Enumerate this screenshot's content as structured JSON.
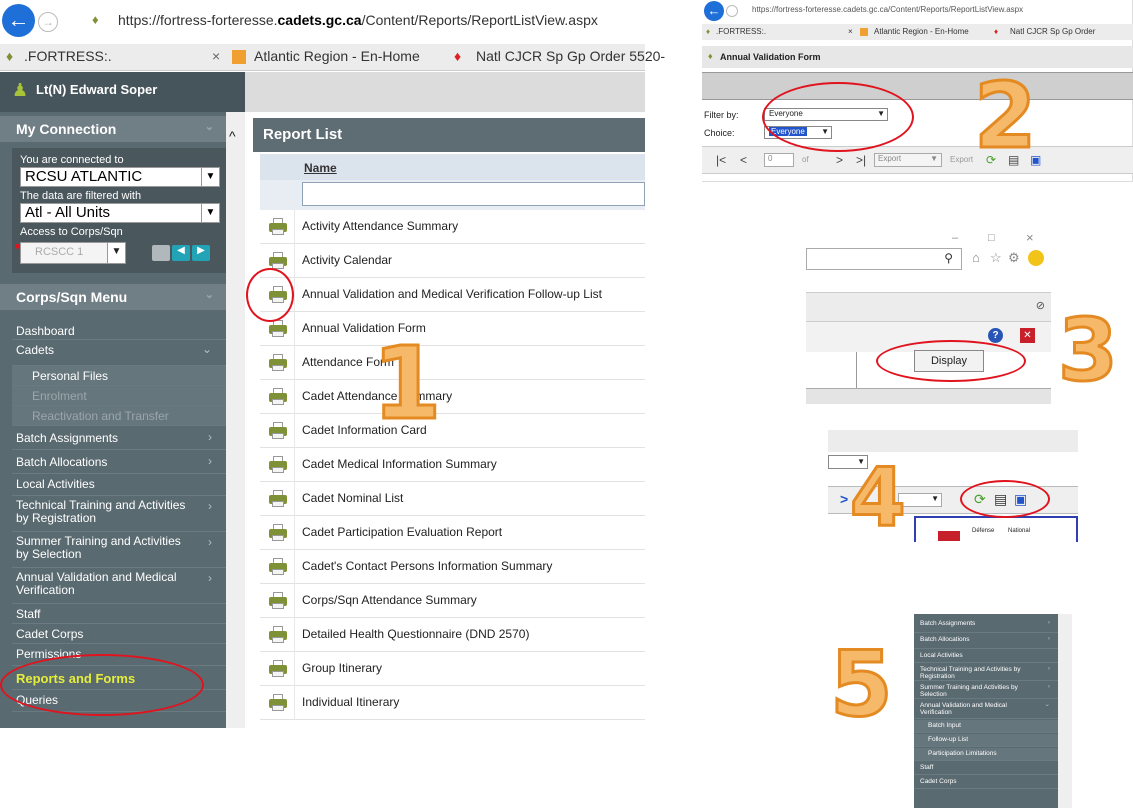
{
  "step_numbers": [
    "1",
    "2",
    "3",
    "4",
    "5"
  ],
  "browser": {
    "url_prefix": "https://fortress-forteresse.",
    "url_domain": "cadets.gc.ca",
    "url_path": "/Content/Reports/ReportListView.aspx",
    "tabs": [
      ".FORTRESS:.",
      "Atlantic Region - En-Home",
      "Natl CJCR Sp Gp Order 5520-"
    ]
  },
  "user": {
    "name": "Lt(N) Edward Soper"
  },
  "connection": {
    "title": "My Connection",
    "connected_label": "You are connected to",
    "connected_value": "RCSU ATLANTIC",
    "filtered_label": "The data are filtered with",
    "filtered_value": "Atl - All Units",
    "access_label": "Access to Corps/Sqn",
    "access_value": "RCSCC 1"
  },
  "menu": {
    "title": "Corps/Sqn Menu",
    "items": [
      {
        "label": "Dashboard",
        "type": "item",
        "chev": ""
      },
      {
        "label": "Cadets",
        "type": "item",
        "chev": "⌄"
      },
      {
        "label": "Personal Files",
        "type": "sub",
        "chev": ""
      },
      {
        "label": "Enrolment",
        "type": "sub-dis",
        "chev": ""
      },
      {
        "label": "Reactivation and Transfer",
        "type": "sub-dis",
        "chev": ""
      },
      {
        "label": "Batch Assignments",
        "type": "item",
        "chev": "›"
      },
      {
        "label": "Batch Allocations",
        "type": "item",
        "chev": "›"
      },
      {
        "label": "Local Activities",
        "type": "item",
        "chev": ""
      },
      {
        "label": "Technical Training and Activities by Registration",
        "type": "item",
        "chev": "›"
      },
      {
        "label": "Summer Training and Activities by Selection",
        "type": "item",
        "chev": "›"
      },
      {
        "label": "Annual Validation and Medical Verification",
        "type": "item",
        "chev": "›"
      },
      {
        "label": "Staff",
        "type": "item",
        "chev": ""
      },
      {
        "label": "Cadet Corps",
        "type": "item",
        "chev": ""
      },
      {
        "label": "Permissions",
        "type": "item",
        "chev": ""
      },
      {
        "label": "Reports and Forms",
        "type": "active",
        "chev": ""
      },
      {
        "label": "Queries",
        "type": "item",
        "chev": ""
      }
    ]
  },
  "report_list": {
    "title": "Report List",
    "column_name": "Name",
    "rows": [
      "Activity Attendance Summary",
      "Activity Calendar",
      "Annual Validation and Medical Verification Follow-up List",
      "Annual Validation Form",
      "Attendance Form",
      "Cadet Attendance Summary",
      "Cadet Information Card",
      "Cadet Medical Information Summary",
      "Cadet Nominal List",
      "Cadet Participation Evaluation Report",
      "Cadet's Contact Persons Information Summary",
      "Corps/Sqn Attendance Summary",
      "Detailed Health Questionnaire (DND 2570)",
      "Group Itinerary",
      "Individual Itinerary"
    ]
  },
  "form": {
    "url": "https://fortress-forteresse.cadets.gc.ca/Content/Reports/ReportListView.aspx",
    "tabs": [
      ".FORTRESS:.",
      "Atlantic Region - En-Home",
      "Natl CJCR Sp Gp Order"
    ],
    "title": "Annual Validation Form",
    "filter_label": "Filter by:",
    "filter_value": "Everyone",
    "choice_label": "Choice:",
    "choice_value": "Everyone",
    "page_value": "0",
    "page_of": "of",
    "export_select": "Export",
    "export_link": "Export"
  },
  "display_button": "Display",
  "logo_text": [
    "Défense",
    "National"
  ],
  "menu_small": [
    {
      "label": "Batch Assignments",
      "type": "item",
      "chev": "›"
    },
    {
      "label": "Batch Allocations",
      "type": "item",
      "chev": "›"
    },
    {
      "label": "Local Activities",
      "type": "item",
      "chev": ""
    },
    {
      "label": "Technical Training and Activities by Registration",
      "type": "item",
      "chev": "›"
    },
    {
      "label": "Summer Training and Activities by Selection",
      "type": "item",
      "chev": "›"
    },
    {
      "label": "Annual Validation and Medical Verification",
      "type": "item",
      "chev": "⌄"
    },
    {
      "label": "Batch Input",
      "type": "sub",
      "chev": ""
    },
    {
      "label": "Follow-up List",
      "type": "sub",
      "chev": ""
    },
    {
      "label": "Participation Limitations",
      "type": "sub",
      "chev": ""
    },
    {
      "label": "Staff",
      "type": "item",
      "chev": ""
    },
    {
      "label": "Cadet Corps",
      "type": "item",
      "chev": ""
    }
  ],
  "colors": {
    "accent_red": "#e0141e",
    "step_orange": "#f6b869",
    "sidebar": "#5a6a71",
    "active_menu": "#e6ee3c"
  }
}
